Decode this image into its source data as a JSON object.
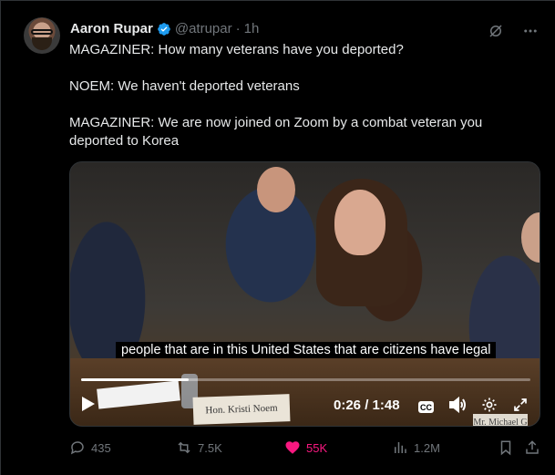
{
  "author": {
    "name": "Aaron Rupar",
    "handle": "@atrupar",
    "separator": "·",
    "time": "1h"
  },
  "tweet_text": [
    "MAGAZINER: How many veterans have you deported?",
    "",
    "NOEM: We haven't deported veterans",
    "",
    "MAGAZINER: We are now joined on Zoom by a combat veteran you deported to Korea"
  ],
  "video": {
    "caption": "people that are in this United States that are citizens have legal",
    "nameplate": "Hon. Kristi Noem",
    "nameplate2": "Mr. Michael G",
    "current_time": "0:26",
    "time_separator": " / ",
    "duration": "1:48",
    "progress_fraction": 0.24,
    "cc_label": "CC"
  },
  "actions": {
    "replies": "435",
    "reposts": "7.5K",
    "likes": "55K",
    "views": "1.2M"
  },
  "colors": {
    "background": "#000000",
    "text": "#e7e9ea",
    "muted": "#71767b",
    "verified": "#1d9bf0",
    "like": "#f91880"
  },
  "icons": [
    "verified-badge-icon",
    "grok-icon",
    "more-icon",
    "play-icon",
    "cc-icon",
    "volume-icon",
    "settings-icon",
    "fullscreen-icon",
    "reply-icon",
    "repost-icon",
    "like-icon",
    "views-icon",
    "bookmark-icon",
    "share-icon"
  ]
}
